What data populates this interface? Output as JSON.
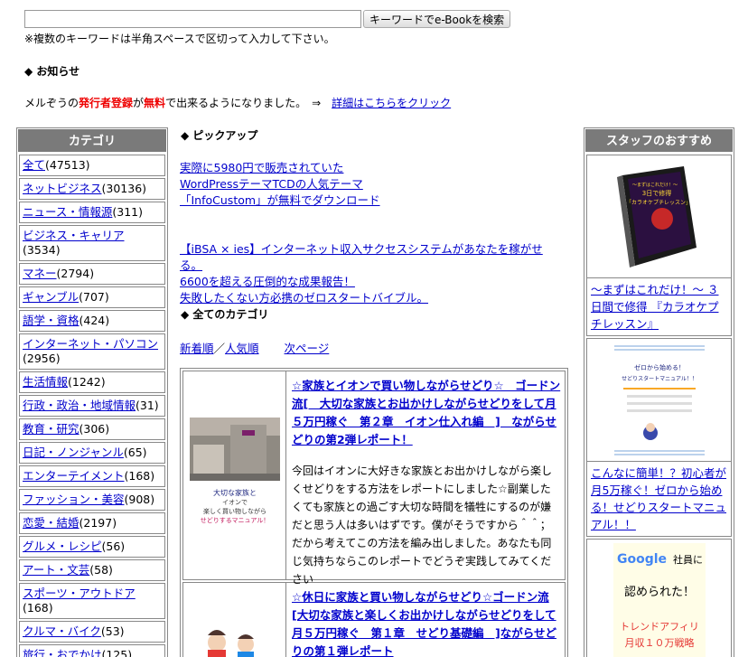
{
  "search": {
    "placeholder": "",
    "button_label": "キーワードでe-Bookを検索",
    "note": "※複数のキーワードは半角スペースで区切って入力して下さい。"
  },
  "notice": {
    "heading": "◆ お知らせ",
    "text_before": "メルぞうの",
    "highlight1": "発行者登録",
    "text_mid": "が",
    "highlight2": "無料",
    "text_after": "で出来るようになりました。　⇒",
    "link": "詳細はこちらをクリック"
  },
  "categories": {
    "header": "カテゴリ",
    "items": [
      {
        "label": "全て",
        "count": "(47513)"
      },
      {
        "label": "ネットビジネス",
        "count": "(30136)"
      },
      {
        "label": "ニュース・情報源",
        "count": "(311)"
      },
      {
        "label": "ビジネス・キャリア",
        "count": "(3534)"
      },
      {
        "label": "マネー",
        "count": "(2794)"
      },
      {
        "label": "ギャンブル",
        "count": "(707)"
      },
      {
        "label": "語学・資格",
        "count": "(424)"
      },
      {
        "label": "インターネット・パソコン",
        "count": "(2956)"
      },
      {
        "label": "生活情報",
        "count": "(1242)"
      },
      {
        "label": "行政・政治・地域情報",
        "count": "(31)"
      },
      {
        "label": "教育・研究",
        "count": "(306)"
      },
      {
        "label": "日記・ノンジャンル",
        "count": "(65)"
      },
      {
        "label": "エンターテイメント",
        "count": "(168)"
      },
      {
        "label": "ファッション・美容",
        "count": "(908)"
      },
      {
        "label": "恋愛・結婚",
        "count": "(2197)"
      },
      {
        "label": "グルメ・レシピ",
        "count": "(56)"
      },
      {
        "label": "アート・文芸",
        "count": "(58)"
      },
      {
        "label": "スポーツ・アウトドア",
        "count": "(168)"
      },
      {
        "label": "クルマ・バイク",
        "count": "(53)"
      },
      {
        "label": "旅行・おでかけ",
        "count": "(125)"
      }
    ]
  },
  "pickup": {
    "heading": "◆ ピックアップ",
    "group1": [
      "実際に5980円で販売されていた",
      "WordPressテーマTCDの人気テーマ",
      "「InfoCustom」が無料でダウンロード"
    ],
    "group2": [
      "【iBSA × ies】インターネット収入サクセスシステムがあなたを稼がせる。",
      "6600を超える圧倒的な成果報告！",
      "失敗したくない方必携のゼロスタートバイブル。"
    ]
  },
  "all_categories": {
    "heading": "◆ 全てのカテゴリ",
    "sort_new": "新着順",
    "separator": "／",
    "sort_popular": "人気順",
    "next_page": "次ページ"
  },
  "ebooks": [
    {
      "title": "☆家族とイオンで買い物しながらせどり☆　ゴードン流[　大切な家族とお出かけしながらせどりをして月５万円稼ぐ　第２章　イオン仕入れ編　]　ながらせどりの第2弾レポート！",
      "description": "今回はイオンに大好きな家族とお出かけしながら楽しくせどりをする方法をレポートにしました☆副業したくても家族との過ごす大切な時間を犠牲にするのが嫌だと思う人は多いはずです。僕がそうですから＾＾；だから考えてこの方法を編み出しました。あなたも同じ気持ちならこのレポートでどうぞ実践してみてください",
      "thumb_caption1": "大切な家族と",
      "thumb_caption2": "イオンで",
      "thumb_caption3": "楽しく買い物しながら",
      "thumb_caption4": "せどりするマニュアル！"
    },
    {
      "title": "☆休日に家族と買い物しながらせどり☆ゴードン流[大切な家族と楽しくお出かけしながらせどりをして月５万円稼ぐ　第１章　せどり基礎編　]ながらせどりの第１弾レポート",
      "description": ""
    }
  ],
  "staff": {
    "header": "スタッフのおすすめ",
    "items": [
      {
        "link": "〜まずはこれだけ！〜 ３日間で修得 『カラオケプチレッスン』",
        "img_text1": "〜まずはこれだけ！〜",
        "img_text2": "3日で修得",
        "img_text3": "「カラオケプチレッスン」"
      },
      {
        "link": "こんなに簡単！？初心者が月5万稼ぐ！ゼロから始める！せどりスタートマニュアル！！",
        "img_text1": "ゼロから始める！",
        "img_text2": "せどりスタートマニュアル！！"
      },
      {
        "link": "",
        "img_text1": "Google",
        "img_text2": "社員に",
        "img_text3": "認められた！",
        "img_text4": "トレンドアフィリ",
        "img_text5": "月収１０万戦略"
      }
    ]
  },
  "colors": {
    "header_bg": "#7a7a7a",
    "link": "#0000cc",
    "highlight": "#ee0000"
  }
}
